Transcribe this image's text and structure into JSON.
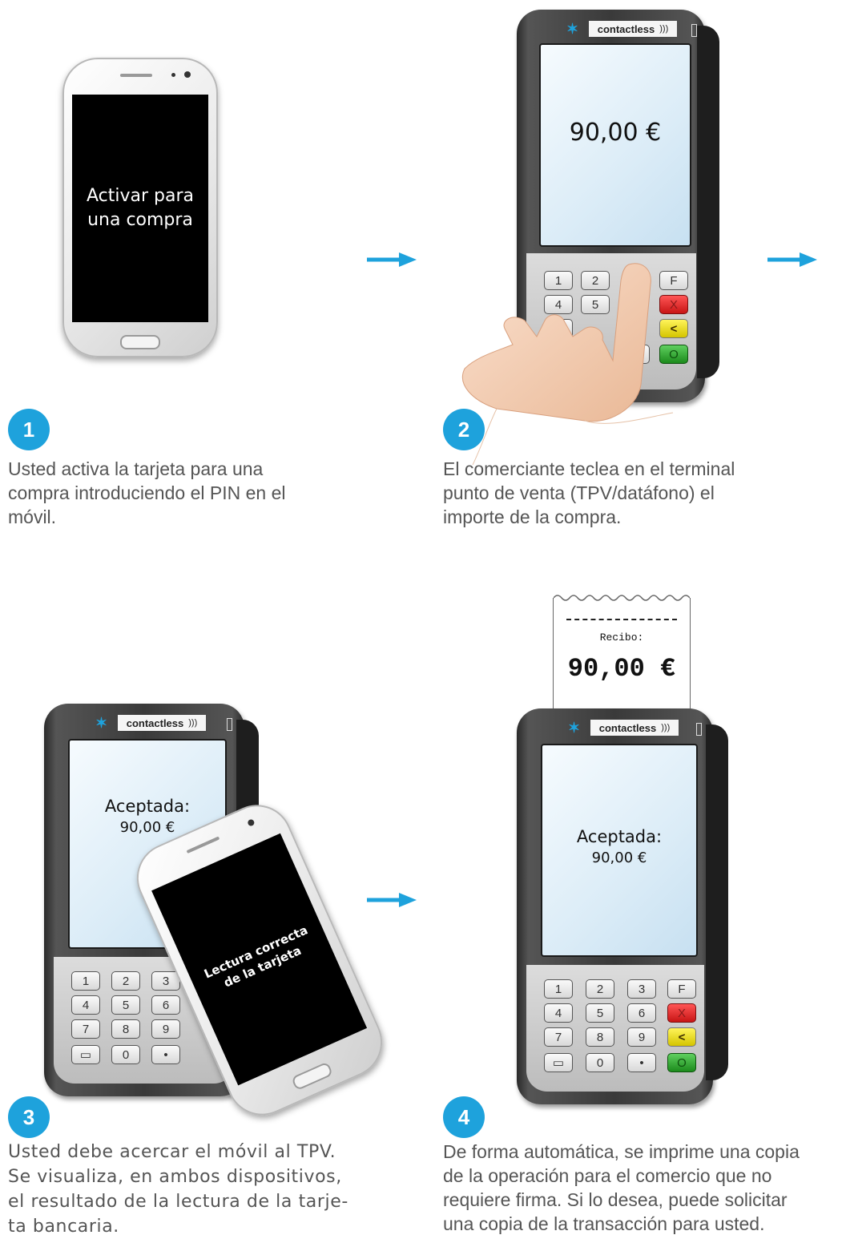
{
  "steps": [
    {
      "number": "1",
      "text_lines": [
        "Usted activa la tarjeta para una",
        "compra introduciendo el PIN en el",
        "móvil."
      ]
    },
    {
      "number": "2",
      "text_lines": [
        "El comerciante teclea en el terminal",
        "punto de venta (TPV/datáfono) el",
        "importe de la compra."
      ]
    },
    {
      "number": "3",
      "text_lines": [
        "Usted debe acercar el móvil al TPV.",
        "Se visualiza, en ambos dispositivos,",
        "el resultado de la lectura de la tarje-",
        "ta bancaria."
      ]
    },
    {
      "number": "4",
      "text_lines": [
        "De forma automática, se imprime una copia",
        "de la operación para el comercio que no",
        "requiere firma. Si lo desea, puede solicitar",
        "una copia de la transacción para usted."
      ]
    }
  ],
  "phone1": {
    "lines": [
      "Activar para",
      "una compra"
    ]
  },
  "phone3": {
    "lines": [
      "Lectura correcta",
      "de la tarjeta"
    ]
  },
  "pos": {
    "brand": "contactless",
    "screen2": "90,00 €",
    "screen3": [
      "Aceptada:",
      "90,00 €"
    ],
    "screen4": [
      "Aceptada:",
      "90,00 €"
    ],
    "keys": [
      "1",
      "2",
      "3",
      "F",
      "4",
      "5",
      "6",
      "X",
      "7",
      "8",
      "9",
      "<",
      "",
      "0",
      "•",
      "O"
    ]
  },
  "receipt": {
    "label": "Recibo:",
    "amount": "90,00 €"
  },
  "colors": {
    "accent": "#1ea2dc",
    "text": "#555555"
  }
}
